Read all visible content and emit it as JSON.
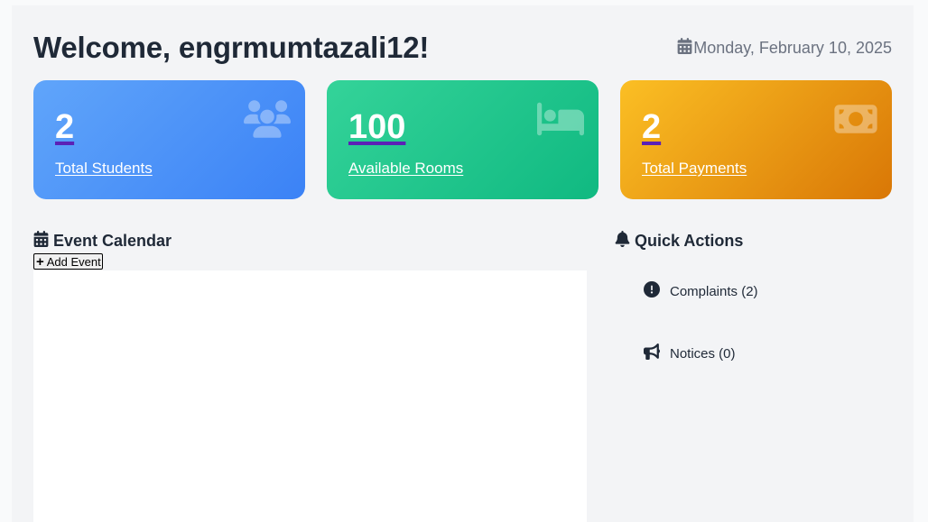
{
  "header": {
    "welcome": "Welcome, engrmumtazali12!",
    "date": "Monday, February 10, 2025"
  },
  "stats": [
    {
      "value": "2",
      "label": "Total Students",
      "icon": "users-icon",
      "color": "#3b82f6"
    },
    {
      "value": "100",
      "label": "Available Rooms",
      "icon": "bed-icon",
      "color": "#10b981"
    },
    {
      "value": "2",
      "label": "Total Payments",
      "icon": "money-bill-icon",
      "color": "#d97706"
    }
  ],
  "calendar": {
    "title": "Event Calendar",
    "add_event_label": "Add Event"
  },
  "quick_actions": {
    "title": "Quick Actions",
    "items": [
      {
        "label": "Complaints (2)",
        "icon": "exclamation-circle-icon"
      },
      {
        "label": "Notices (0)",
        "icon": "bullhorn-icon"
      }
    ]
  }
}
